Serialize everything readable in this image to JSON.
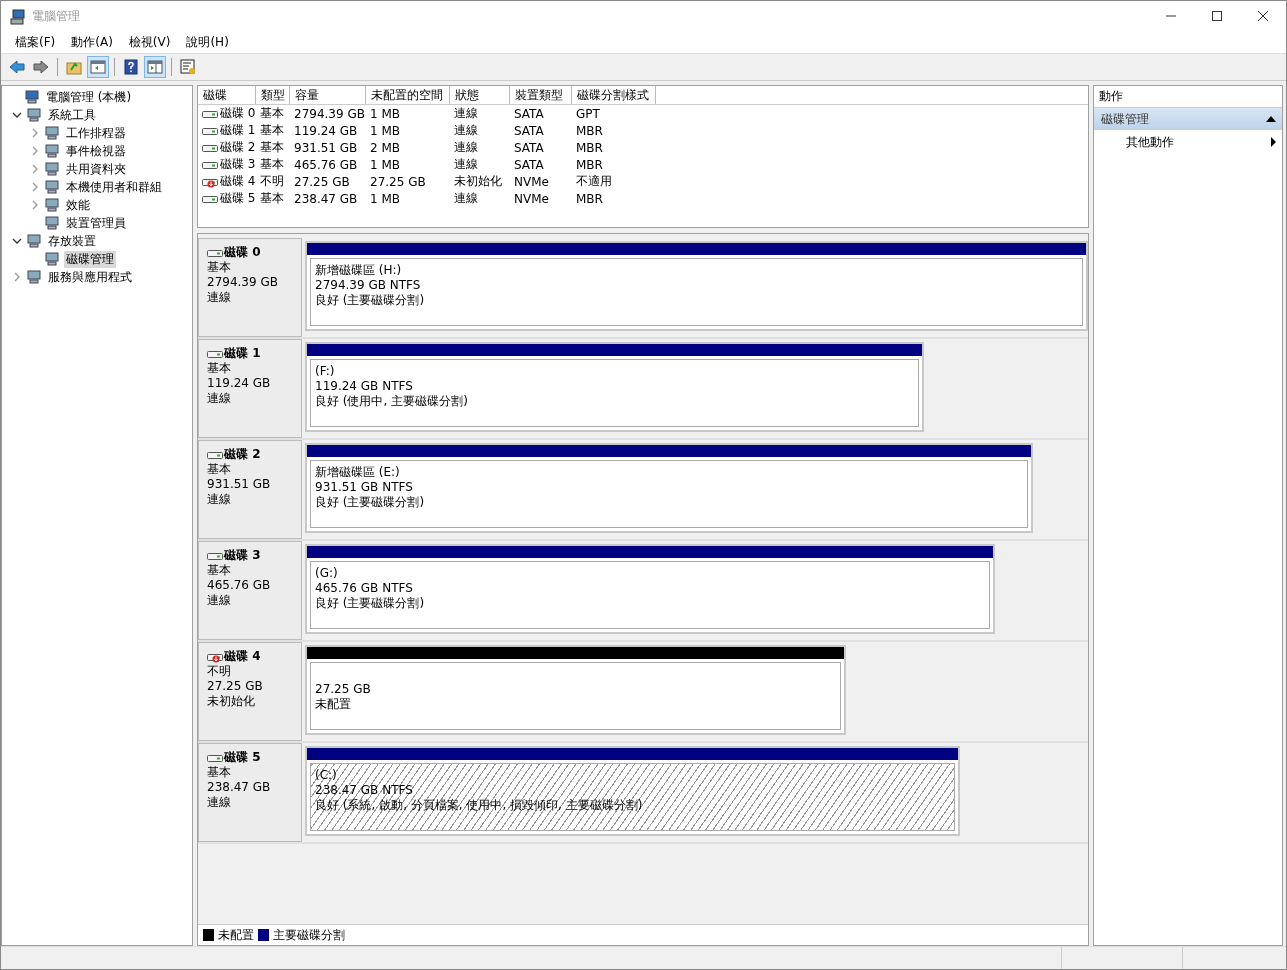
{
  "window": {
    "title": "電腦管理"
  },
  "menu": [
    "檔案(F)",
    "動作(A)",
    "檢視(V)",
    "說明(H)"
  ],
  "toolbar": [
    {
      "kind": "back",
      "pressed": false
    },
    {
      "kind": "forward",
      "pressed": false
    },
    {
      "kind": "separator"
    },
    {
      "kind": "up",
      "pressed": false
    },
    {
      "kind": "tree",
      "pressed": true
    },
    {
      "kind": "separator"
    },
    {
      "kind": "help",
      "pressed": false
    },
    {
      "kind": "pane",
      "pressed": true
    },
    {
      "kind": "separator"
    },
    {
      "kind": "properties",
      "pressed": false
    }
  ],
  "tree": [
    {
      "label": "電腦管理 (本機)",
      "selected": false,
      "children": [
        {
          "label": "系統工具",
          "expanded": true,
          "selected": false,
          "children": [
            {
              "label": "工作排程器",
              "expanded": false,
              "selected": false
            },
            {
              "label": "事件檢視器",
              "expanded": false,
              "selected": false
            },
            {
              "label": "共用資料夾",
              "expanded": false,
              "selected": false
            },
            {
              "label": "本機使用者和群組",
              "expanded": false,
              "selected": false
            },
            {
              "label": "效能",
              "expanded": false,
              "selected": false
            },
            {
              "label": "裝置管理員",
              "selected": false
            }
          ]
        },
        {
          "label": "存放裝置",
          "expanded": true,
          "selected": false,
          "children": [
            {
              "label": "磁碟管理",
              "selected": true
            }
          ]
        },
        {
          "label": "服務與應用程式",
          "expanded": false,
          "selected": false
        }
      ]
    }
  ],
  "table": {
    "columns": [
      "磁碟",
      "類型",
      "容量",
      "未配置的空間",
      "狀態",
      "裝置類型",
      "磁碟分割樣式"
    ],
    "rows": [
      {
        "warning": false,
        "cells": [
          "磁碟 0",
          "基本",
          "2794.39 GB",
          "1 MB",
          "連線",
          "SATA",
          "GPT"
        ]
      },
      {
        "warning": false,
        "cells": [
          "磁碟 1",
          "基本",
          "119.24 GB",
          "1 MB",
          "連線",
          "SATA",
          "MBR"
        ]
      },
      {
        "warning": false,
        "cells": [
          "磁碟 2",
          "基本",
          "931.51 GB",
          "2 MB",
          "連線",
          "SATA",
          "MBR"
        ]
      },
      {
        "warning": false,
        "cells": [
          "磁碟 3",
          "基本",
          "465.76 GB",
          "1 MB",
          "連線",
          "SATA",
          "MBR"
        ]
      },
      {
        "warning": true,
        "cells": [
          "磁碟 4",
          "不明",
          "27.25 GB",
          "27.25 GB",
          "未初始化",
          "NVMe",
          "不適用"
        ]
      },
      {
        "warning": false,
        "cells": [
          "磁碟 5",
          "基本",
          "238.47 GB",
          "1 MB",
          "連線",
          "NVMe",
          "MBR"
        ]
      }
    ]
  },
  "disks": [
    {
      "name": "磁碟 0",
      "type": "基本",
      "size": "2794.39 GB",
      "status": "連線",
      "warning": false,
      "partition": {
        "kind": "primary",
        "selected": false,
        "lines": [
          "新增磁碟區  (H:)",
          "2794.39 GB NTFS",
          "良好 (主要磁碟分割)"
        ]
      }
    },
    {
      "name": "磁碟 1",
      "type": "基本",
      "size": "119.24 GB",
      "status": "連線",
      "warning": false,
      "partition": {
        "kind": "primary",
        "selected": false,
        "lines": [
          "(F:)",
          "119.24 GB NTFS",
          "良好 (使用中, 主要磁碟分割)"
        ]
      }
    },
    {
      "name": "磁碟 2",
      "type": "基本",
      "size": "931.51 GB",
      "status": "連線",
      "warning": false,
      "partition": {
        "kind": "primary",
        "selected": false,
        "lines": [
          "新增磁碟區  (E:)",
          "931.51 GB NTFS",
          "良好 (主要磁碟分割)"
        ]
      }
    },
    {
      "name": "磁碟 3",
      "type": "基本",
      "size": "465.76 GB",
      "status": "連線",
      "warning": false,
      "partition": {
        "kind": "primary",
        "selected": false,
        "lines": [
          "(G:)",
          "465.76 GB NTFS",
          "良好 (主要磁碟分割)"
        ]
      }
    },
    {
      "name": "磁碟 4",
      "type": "不明",
      "size": "27.25 GB",
      "status": "未初始化",
      "warning": true,
      "partition": {
        "kind": "unallocated",
        "selected": false,
        "lines": [
          "27.25 GB",
          "未配置"
        ]
      }
    },
    {
      "name": "磁碟 5",
      "type": "基本",
      "size": "238.47 GB",
      "status": "連線",
      "warning": false,
      "partition": {
        "kind": "primary",
        "selected": true,
        "lines": [
          "(C:)",
          "238.47 GB NTFS",
          "良好 (系統, 啟動, 分頁檔案, 使用中, 損毀傾印, 主要磁碟分割)"
        ]
      }
    }
  ],
  "legend": [
    {
      "label": "未配置",
      "color": "#000000"
    },
    {
      "label": "主要磁碟分割",
      "color": "#000080"
    }
  ],
  "actions": {
    "title": "動作",
    "section": {
      "label": "磁碟管理",
      "expanded": true,
      "items": [
        {
          "label": "其他動作",
          "submenu": true
        }
      ]
    }
  }
}
